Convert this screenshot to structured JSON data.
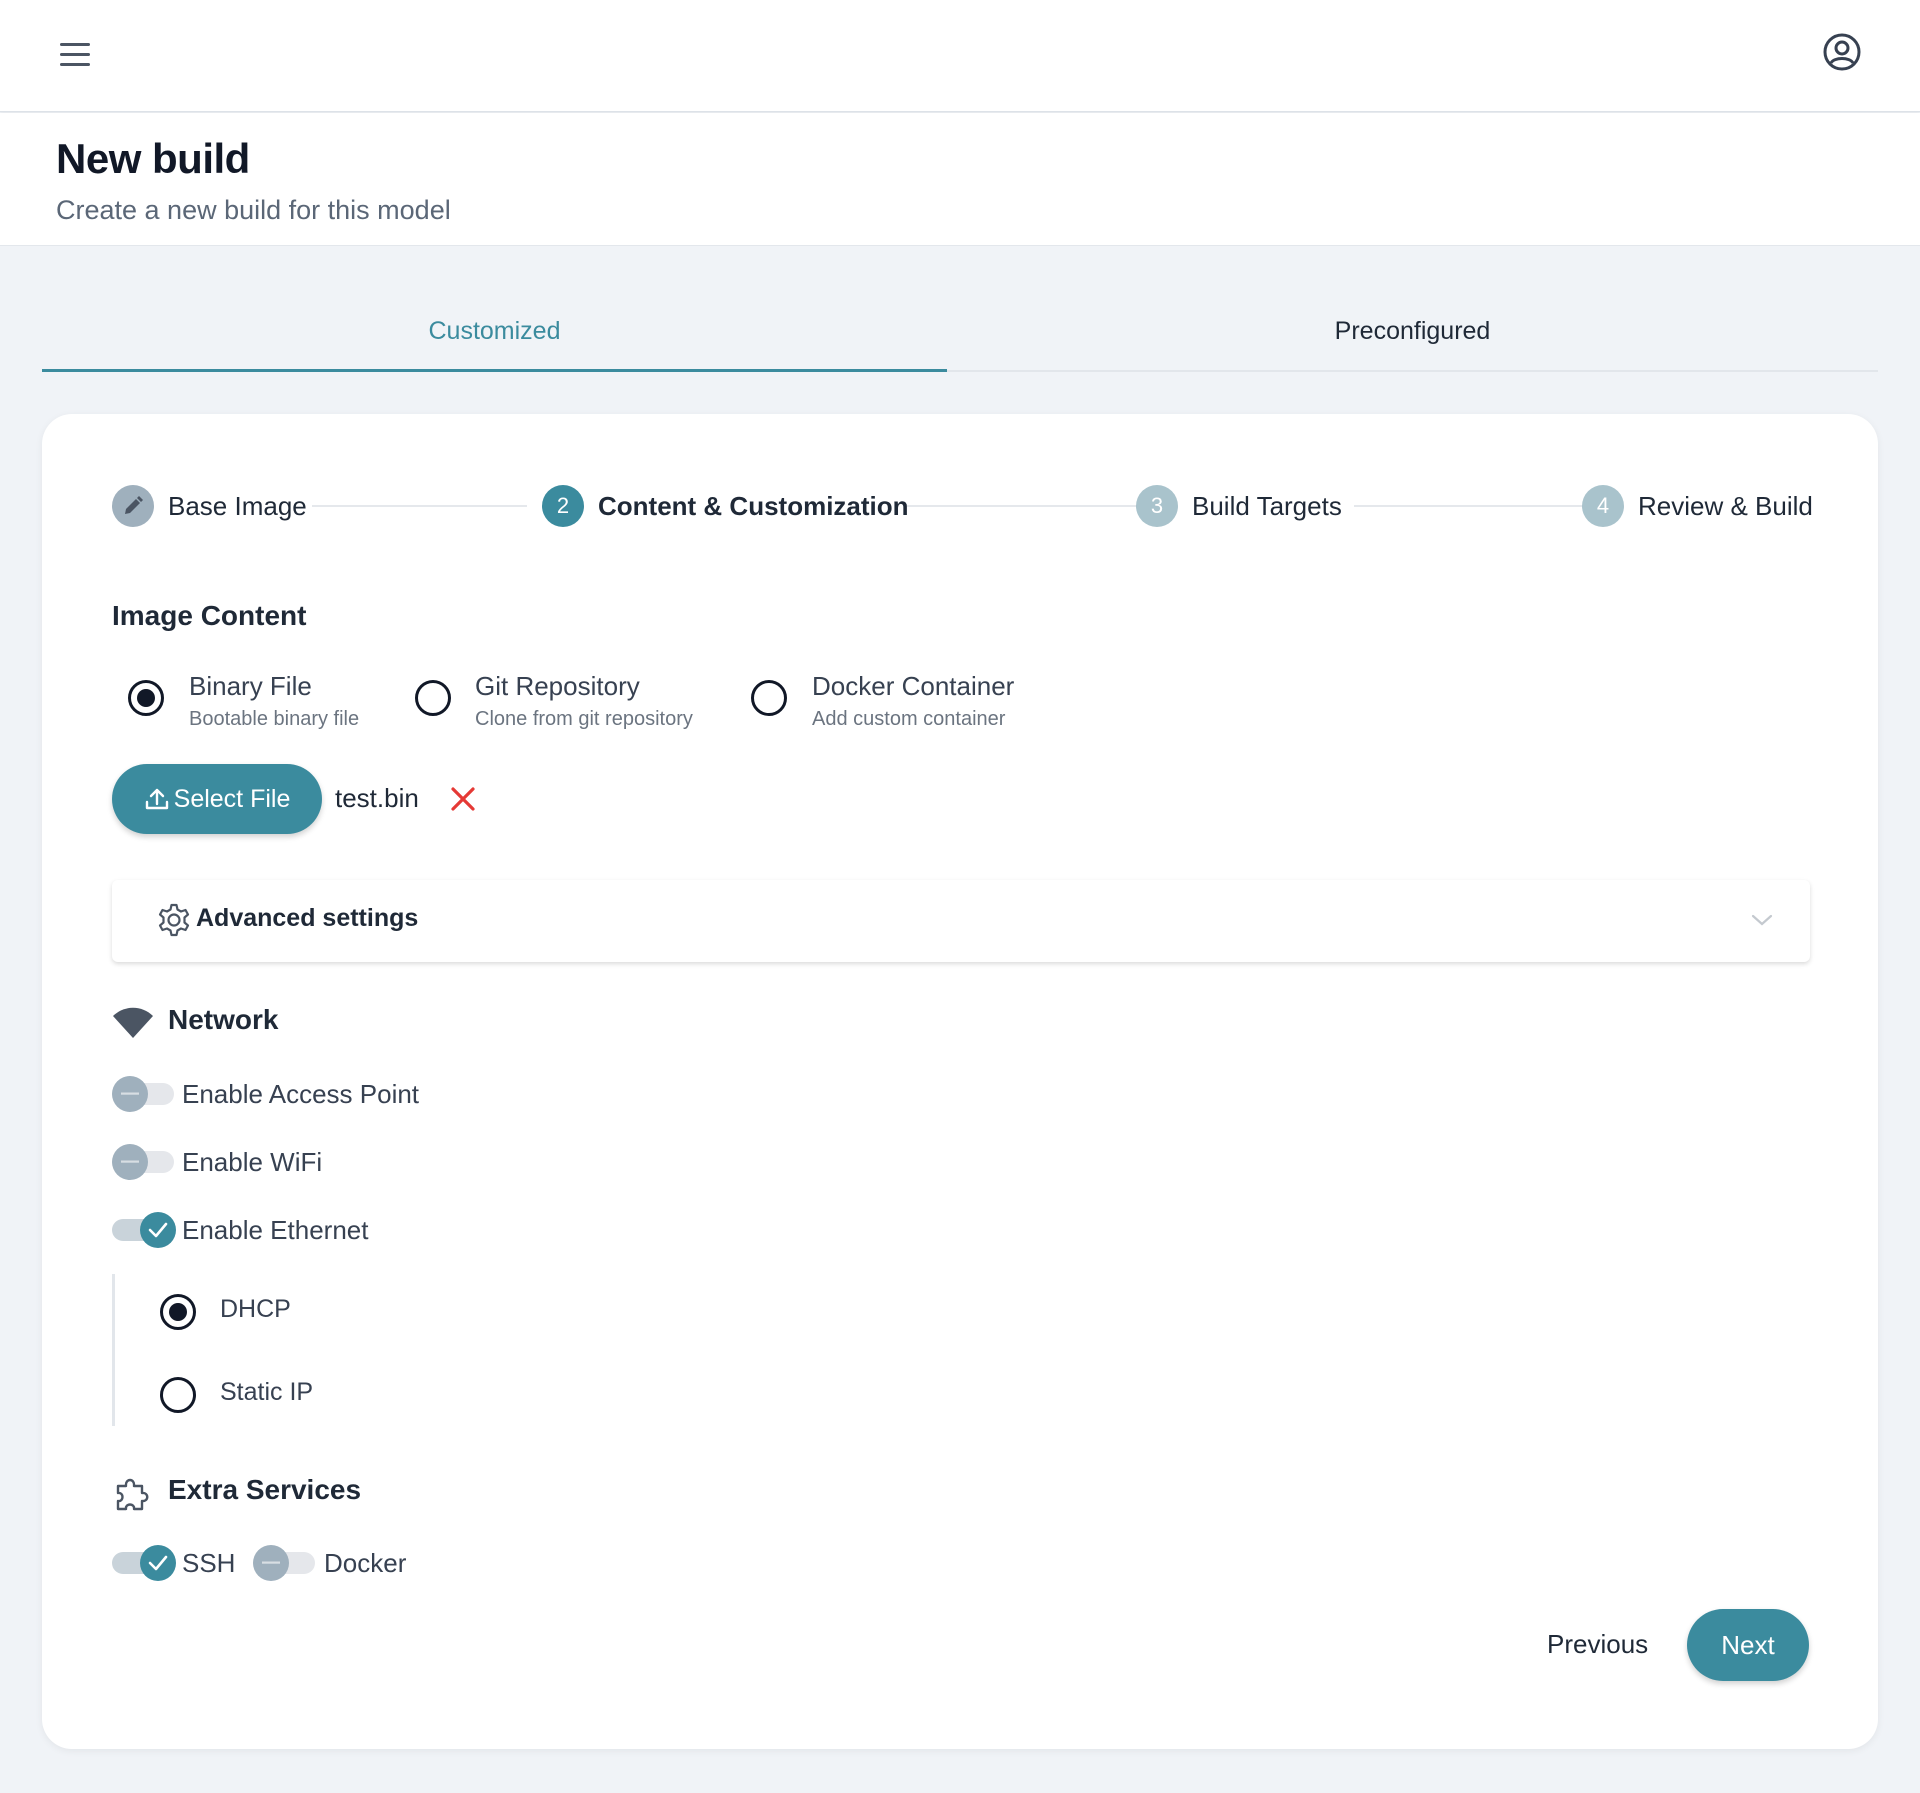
{
  "header": {
    "title": "New build",
    "subtitle": "Create a new build for this model"
  },
  "tabs": [
    {
      "label": "Customized",
      "active": true
    },
    {
      "label": "Preconfigured",
      "active": false
    }
  ],
  "stepper": {
    "steps": [
      {
        "number": "",
        "label": "Base Image",
        "state": "completed"
      },
      {
        "number": "2",
        "label": "Content & Customization",
        "state": "active"
      },
      {
        "number": "3",
        "label": "Build Targets",
        "state": "pending"
      },
      {
        "number": "4",
        "label": "Review & Build",
        "state": "pending"
      }
    ]
  },
  "image_content": {
    "title": "Image Content",
    "options": [
      {
        "label": "Binary File",
        "description": "Bootable binary file",
        "selected": true
      },
      {
        "label": "Git Repository",
        "description": "Clone from git repository",
        "selected": false
      },
      {
        "label": "Docker Container",
        "description": "Add custom container",
        "selected": false
      }
    ],
    "select_file_label": "Select File",
    "file_name": "test.bin"
  },
  "advanced": {
    "label": "Advanced settings"
  },
  "network": {
    "title": "Network",
    "toggles": [
      {
        "label": "Enable Access Point",
        "on": false
      },
      {
        "label": "Enable WiFi",
        "on": false
      },
      {
        "label": "Enable Ethernet",
        "on": true
      }
    ],
    "ethernet_modes": [
      {
        "label": "DHCP",
        "selected": true
      },
      {
        "label": "Static IP",
        "selected": false
      }
    ]
  },
  "extra_services": {
    "title": "Extra Services",
    "toggles": [
      {
        "label": "SSH",
        "on": true
      },
      {
        "label": "Docker",
        "on": false
      }
    ]
  },
  "footer": {
    "previous_label": "Previous",
    "next_label": "Next"
  },
  "colors": {
    "accent": "#3b8b9e",
    "danger": "#e53935",
    "background": "#f0f3f7"
  },
  "icons": {
    "menu": "menu-icon",
    "user": "user-circle-icon",
    "edit": "pencil-icon",
    "upload": "upload-icon",
    "remove": "close-icon",
    "settings": "gear-icon",
    "expand": "chevron-down-icon",
    "network": "wifi-icon",
    "services": "puzzle-icon"
  }
}
